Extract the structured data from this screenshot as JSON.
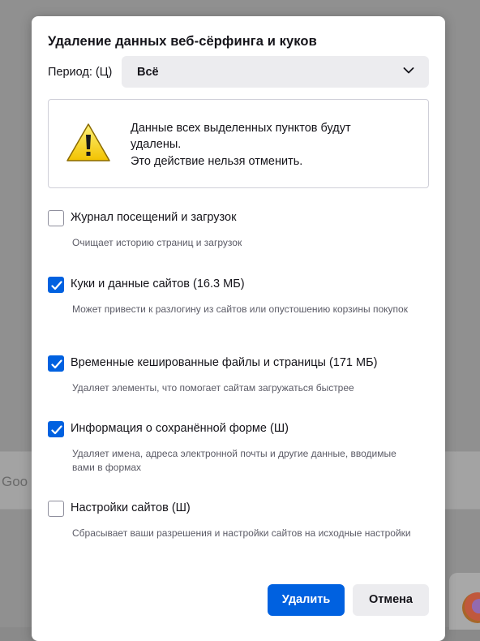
{
  "background": {
    "search_text": "Goo"
  },
  "dialog": {
    "title": "Удаление данных веб-сёрфинга и куков",
    "period": {
      "label": "Период: (Ц)",
      "selected": "Всё"
    },
    "warning": {
      "line1": "Данные всех выделенных пунктов будут удалены.",
      "line2": "Это действие нельзя отменить."
    },
    "options": [
      {
        "label": "Журнал посещений и загрузок",
        "description": "Очищает историю страниц и загрузок",
        "checked": false
      },
      {
        "label": "Куки и данные сайтов (16.3 МБ)",
        "description": "Может привести к разлогину из сайтов или опустошению корзины покупок",
        "checked": true
      },
      {
        "label": "Временные кешированные файлы и страницы (171 МБ)",
        "description": "Удаляет элементы, что помогает сайтам загружаться быстрее",
        "checked": true
      },
      {
        "label": "Информация о сохранённой форме (Ш)",
        "description": "Удаляет имена, адреса электронной почты и другие данные, вводимые вами в формах",
        "checked": true
      },
      {
        "label": "Настройки сайтов (Ш)",
        "description": "Сбрасывает ваши разрешения и настройки сайтов на исходные настройки",
        "checked": false
      }
    ],
    "buttons": {
      "delete": "Удалить",
      "cancel": "Отмена"
    }
  },
  "colors": {
    "accent": "#0061e0",
    "dialog_bg": "#ffffff",
    "select_bg": "#ececef",
    "overlay": "#909090"
  },
  "icons": {
    "warning": "warning-triangle-icon",
    "chevron": "chevron-down-icon",
    "check": "checkmark-icon"
  }
}
